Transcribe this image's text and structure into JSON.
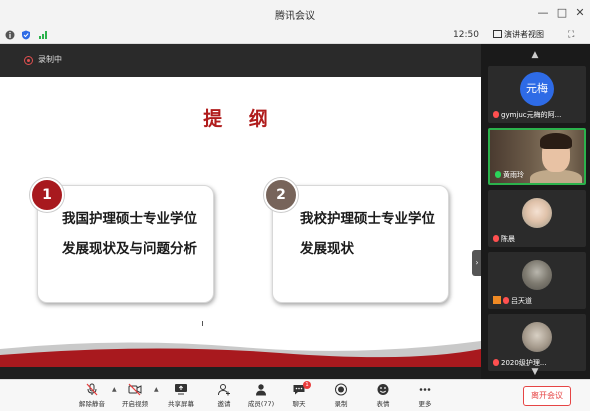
{
  "window": {
    "title": "腾讯会议"
  },
  "infobar": {
    "clock": "12:50",
    "view_mode": "演讲者视图"
  },
  "recording": {
    "label": "录制中",
    "color": "#e05050"
  },
  "slide": {
    "title": "提 纲",
    "cards": [
      {
        "number": "1",
        "text": "我国护理硕士专业学位发展现状及与问题分析",
        "badge_color": "#a8191e"
      },
      {
        "number": "2",
        "text": "我校护理硕士专业学位发展现状",
        "badge_color": "#77645a"
      }
    ],
    "accent_color": "#b01c1c"
  },
  "participants": [
    {
      "name": "gymjuc元梅的阿...",
      "avatar_text": "元梅",
      "mic": "muted",
      "type": "avatar"
    },
    {
      "name": "黄雨玲",
      "mic": "speaking",
      "type": "video",
      "active": true
    },
    {
      "name": "陈晨",
      "mic": "muted",
      "type": "photo"
    },
    {
      "name": "吕天道",
      "mic": "muted",
      "type": "photo",
      "sharing": true
    },
    {
      "name": "2020级护理...",
      "mic": "muted",
      "type": "photo"
    }
  ],
  "toolbar": {
    "mute": "解除静音",
    "video": "开启视频",
    "share": "共享屏幕",
    "invite": "邀请",
    "members": "成员(77)",
    "chat": "聊天",
    "chat_badge": "1",
    "record": "录制",
    "emoji": "表情",
    "more": "更多",
    "leave": "离开会议"
  }
}
